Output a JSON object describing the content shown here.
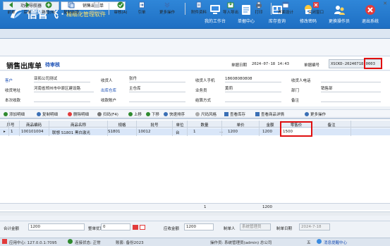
{
  "app": {
    "logo_text": "信管飞",
    "logo_sub": "精细化管理软件",
    "header_buttons": [
      {
        "label": "我的工作台",
        "icon": "monitor-icon"
      },
      {
        "label": "单据中心",
        "icon": "documents-icon"
      },
      {
        "label": "库存查询",
        "icon": "inventory-icon"
      },
      {
        "label": "修改密码",
        "icon": "key-icon"
      },
      {
        "label": "更换操作员",
        "icon": "user-switch-icon"
      },
      {
        "label": "退出系统",
        "icon": "exit-icon"
      }
    ]
  },
  "tabs": [
    {
      "label": "功能导航器",
      "active": false
    },
    {
      "label": "销售出库单",
      "active": true
    }
  ],
  "toolbar": [
    {
      "label": "前单",
      "icon": "prev-icon"
    },
    {
      "label": "后单",
      "icon": "next-icon"
    },
    {
      "label": "新增(N)",
      "icon": "add-icon"
    },
    {
      "label": "复制新增",
      "icon": "copy-add-icon"
    },
    {
      "label": "保存(S)",
      "icon": "save-icon",
      "disabled": true
    },
    {
      "label": "审核(A)",
      "icon": "approve-icon"
    },
    {
      "label": "引单",
      "icon": "import-doc-icon"
    },
    {
      "label": "更多操作",
      "icon": "more-icon"
    },
    {
      "label": "附件资料",
      "icon": "attachment-icon"
    },
    {
      "label": "导入导出",
      "icon": "import-export-icon"
    },
    {
      "label": "打印",
      "icon": "print-icon"
    },
    {
      "label": "界面设计",
      "icon": "design-icon"
    },
    {
      "label": "关闭窗口",
      "icon": "close-window-icon"
    }
  ],
  "document": {
    "title": "销售出库单",
    "status": "待审核",
    "date_label": "单据日期",
    "date_value": "2024-07-18 14:43",
    "no_label": "单据编号",
    "no_value": "XSCKD-20240718-0003"
  },
  "form": {
    "customer_label": "客户",
    "customer": "亚拓公司测试",
    "receiver_label": "收货人",
    "receiver": "张丹",
    "receiver_phone_label": "收货人手机",
    "receiver_phone": "18608080808",
    "receiver_tel_label": "收货人电话",
    "receiver_tel": "",
    "address_label": "收货地址",
    "address": "河南省郑州市中原区建设路",
    "warehouse_label": "出库仓库",
    "warehouse": "主仓库",
    "salesman_label": "业务员",
    "salesman": "黄莉",
    "dept_label": "部门",
    "dept": "销售部",
    "collected_label": "本次收款",
    "collected": "",
    "account_label": "收款账户",
    "account": "",
    "settle_label": "结算方式",
    "settle": "",
    "remark_label": "备注",
    "remark": ""
  },
  "grid_toolbar": [
    "添加明细",
    "复制明细",
    "删除明细",
    "扫码(F4)",
    "上移",
    "下移",
    "快速排序",
    "尺码风格",
    "查看库存",
    "查看商品详情",
    "更多操作"
  ],
  "table": {
    "columns": [
      "序号",
      "商品编码",
      "商品名称",
      "规格",
      "批号",
      "单位",
      "数量",
      "单价",
      "金额",
      "零售价",
      "备注"
    ],
    "rows": [
      {
        "seq": "1",
        "code": "100101004",
        "name": "联想 S1801 黑白激光",
        "spec": "S1801",
        "batch": "10012",
        "unit": "台",
        "qty": "1",
        "price": "1200",
        "amount": "1200",
        "retail": "1500",
        "remark": ""
      }
    ],
    "sum_qty": "1",
    "sum_amount": "1200"
  },
  "footer": {
    "total_label": "合计金额",
    "total": "1200",
    "discount_label": "整单优惠",
    "discount": "0",
    "receivable_label": "应收金额",
    "receivable": "1200",
    "maker_label": "制单人",
    "maker": "系统管理员",
    "make_date_label": "制单日期",
    "make_date": "2024-7-18"
  },
  "statusbar": {
    "center": "应用中心: 127.0.0.1:7095",
    "conn": "连接状态: 正常",
    "account": "账套: 备份2023",
    "operator": "操作员: 系统管理员(admin) 总公司",
    "ime": "五",
    "msg": "消息提醒中心"
  }
}
